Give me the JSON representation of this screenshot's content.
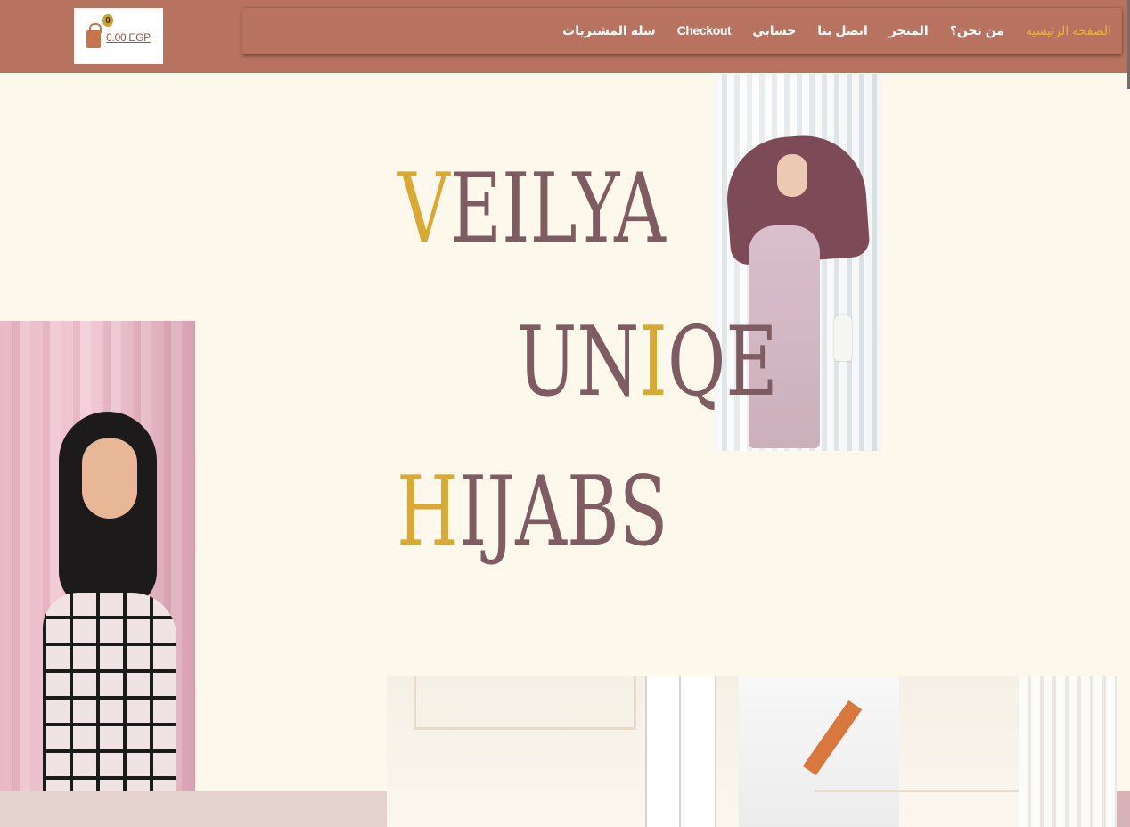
{
  "header": {
    "cart": {
      "count": "0",
      "total": "0.00 EGP",
      "icon": "shopping-bag-icon"
    },
    "nav": [
      {
        "label": "الصفحة الرئيسية",
        "active": true
      },
      {
        "label": "من نحن؟",
        "active": false
      },
      {
        "label": "المتجر",
        "active": false
      },
      {
        "label": "اتصل بنا",
        "active": false
      },
      {
        "label": "حسابي",
        "active": false
      },
      {
        "label": "Checkout",
        "active": false
      },
      {
        "label": "سلة المشتريات",
        "active": false
      }
    ]
  },
  "hero": {
    "line1": {
      "accent": "V",
      "rest": "EILYA"
    },
    "line2": {
      "before": "UN",
      "accent": "I",
      "after": "QE"
    },
    "line3": {
      "accent": "H",
      "rest": "IJABS"
    }
  },
  "colors": {
    "header_bg": "#b87360",
    "page_bg": "#fdf8ec",
    "accent_gold": "#d9aa32",
    "text_mauve": "#7e5c61",
    "nav_active": "#e9b43a"
  }
}
